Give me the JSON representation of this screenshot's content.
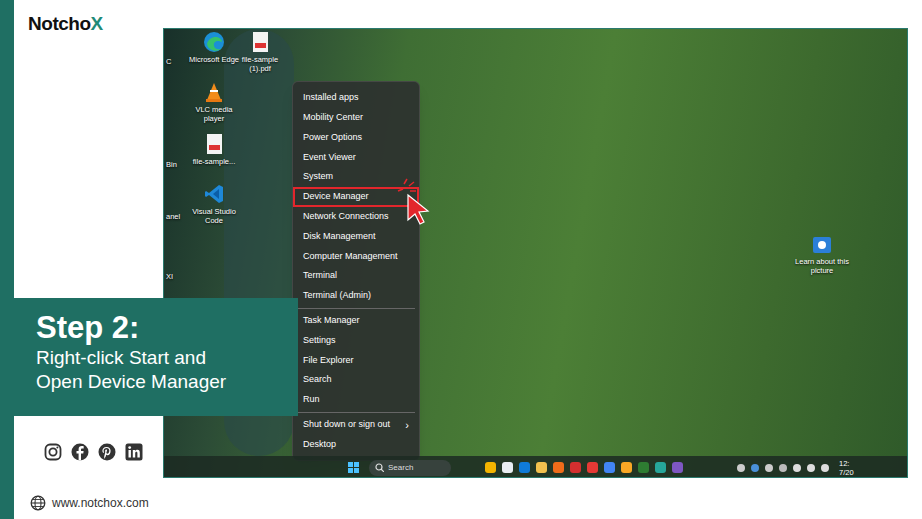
{
  "brand": {
    "logo": "Notcho",
    "logo_accent": "X"
  },
  "step": {
    "title": "Step 2:",
    "lines": [
      "Right-click Start and",
      "Open Device Manager"
    ]
  },
  "website": "www.notchox.com",
  "desktop": {
    "icons": [
      {
        "label": "Microsoft Edge"
      },
      {
        "label": "file-sample (1).pdf"
      },
      {
        "label": "VLC media player"
      },
      {
        "label": "file-sample..."
      },
      {
        "label": "Visual Studio Code"
      }
    ],
    "partial_labels": [
      "C",
      "Bin",
      "anel",
      "XI"
    ],
    "learn": "Learn about this picture"
  },
  "menu": {
    "groups": [
      [
        {
          "label": "Installed apps",
          "selected": false
        },
        {
          "label": "Mobility Center",
          "selected": false
        },
        {
          "label": "Power Options",
          "selected": false
        },
        {
          "label": "Event Viewer",
          "selected": false
        },
        {
          "label": "System",
          "selected": false
        },
        {
          "label": "Device Manager",
          "selected": true
        },
        {
          "label": "Network Connections",
          "selected": false
        },
        {
          "label": "Disk Management",
          "selected": false
        },
        {
          "label": "Computer Management",
          "selected": false
        },
        {
          "label": "Terminal",
          "selected": false
        },
        {
          "label": "Terminal (Admin)",
          "selected": false
        }
      ],
      [
        {
          "label": "Task Manager",
          "selected": false
        },
        {
          "label": "Settings",
          "selected": false
        },
        {
          "label": "File Explorer",
          "selected": false
        },
        {
          "label": "Search",
          "selected": false
        },
        {
          "label": "Run",
          "selected": false
        }
      ],
      [
        {
          "label": "Shut down or sign out",
          "selected": false,
          "arrow": "›"
        },
        {
          "label": "Desktop",
          "selected": false
        }
      ]
    ]
  },
  "taskbar": {
    "search": "Search",
    "time": "12:",
    "date": "7/20"
  }
}
